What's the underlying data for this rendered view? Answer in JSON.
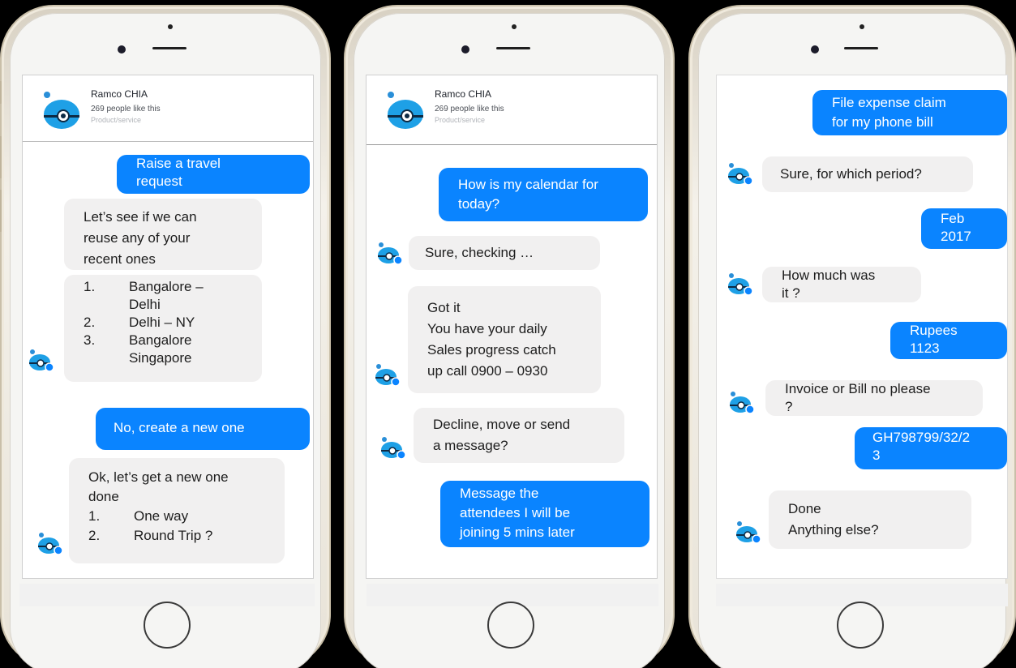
{
  "colors": {
    "user_bubble": "#0a84ff",
    "bot_bubble": "#f1f0f0",
    "brand_blue": "#1ea0e6"
  },
  "icons": {
    "bot_avatar": "robot-avatar-icon",
    "messenger_badge": "messenger-badge-icon"
  },
  "page": {
    "name": "Ramco CHIA",
    "likes": "269 people like this",
    "category": "Product/service"
  },
  "phones": [
    {
      "messages": [
        {
          "from": "user",
          "lines": [
            "Raise a travel",
            "request"
          ]
        },
        {
          "from": "bot",
          "lines": [
            "Let’s see if we can",
            "reuse any of your",
            "recent ones"
          ]
        },
        {
          "from": "bot",
          "list": [
            {
              "num": "1.",
              "lines": [
                "Bangalore –",
                "Delhi"
              ]
            },
            {
              "num": "2.",
              "lines": [
                "Delhi – NY"
              ]
            },
            {
              "num": "3.",
              "lines": [
                "Bangalore",
                "Singapore"
              ]
            }
          ]
        },
        {
          "from": "user",
          "lines": [
            "No, create a new one"
          ]
        },
        {
          "from": "bot",
          "lines": [
            "Ok, let’s get a new one",
            "done"
          ],
          "list": [
            {
              "num": "1.",
              "lines": [
                "One way"
              ]
            },
            {
              "num": "2.",
              "lines": [
                "Round Trip ?"
              ]
            }
          ]
        }
      ]
    },
    {
      "messages": [
        {
          "from": "user",
          "lines": [
            "How is my calendar for",
            "today?"
          ]
        },
        {
          "from": "bot",
          "lines": [
            "Sure, checking …"
          ]
        },
        {
          "from": "bot",
          "lines": [
            "Got it",
            "You have your daily",
            "Sales progress catch",
            "up call 0900 – 0930"
          ]
        },
        {
          "from": "bot",
          "lines": [
            "Decline, move or send",
            "a message?"
          ]
        },
        {
          "from": "user",
          "lines": [
            "Message the",
            "attendees I will be",
            "joining 5 mins later"
          ]
        }
      ]
    },
    {
      "messages": [
        {
          "from": "user",
          "lines": [
            "File expense claim",
            "for my phone bill"
          ]
        },
        {
          "from": "bot",
          "lines": [
            "Sure, for which period?"
          ]
        },
        {
          "from": "user",
          "lines": [
            "Feb",
            "2017"
          ]
        },
        {
          "from": "bot",
          "lines": [
            "How much was",
            "it ?"
          ]
        },
        {
          "from": "user",
          "lines": [
            "Rupees",
            "1123"
          ]
        },
        {
          "from": "bot",
          "lines": [
            "Invoice or Bill no please",
            "?"
          ]
        },
        {
          "from": "user",
          "lines": [
            "GH798799/32/2",
            "3"
          ]
        },
        {
          "from": "bot",
          "lines": [
            "Done",
            "Anything else?"
          ]
        }
      ]
    }
  ]
}
